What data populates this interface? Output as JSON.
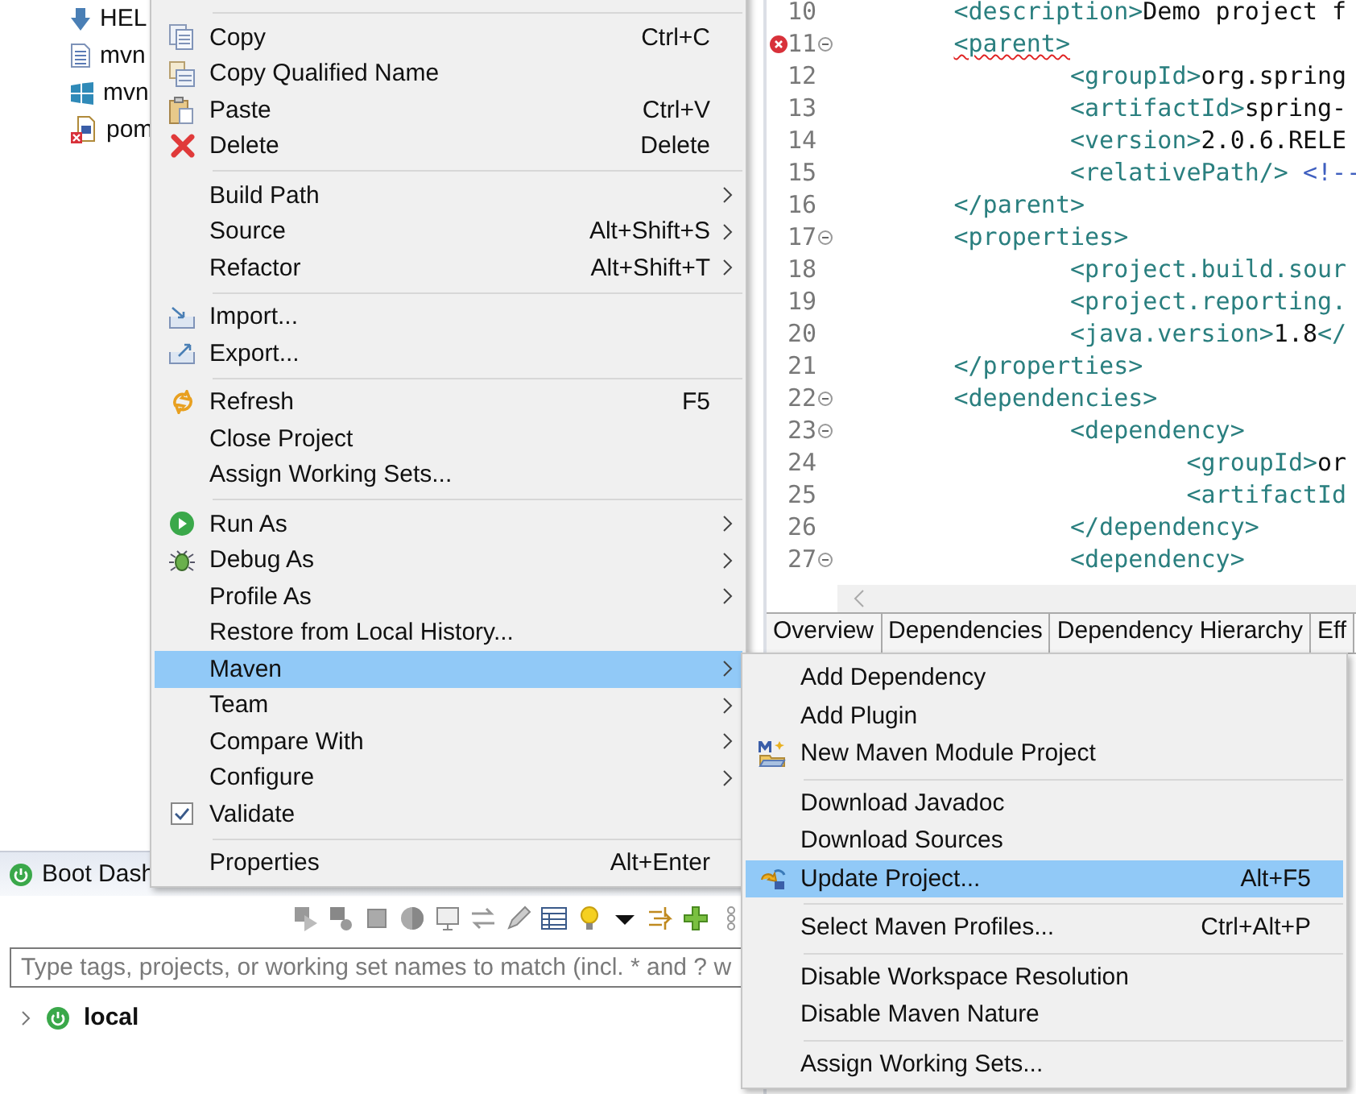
{
  "explorer": {
    "items": [
      {
        "label": "HEL"
      },
      {
        "label": "mvn"
      },
      {
        "label": "mvn"
      },
      {
        "label": "pom"
      }
    ]
  },
  "boot_dashboard": {
    "tab": {
      "label": "Boot Dash"
    },
    "search": {
      "placeholder": "Type tags, projects, or working set names to match (incl. * and ? w"
    },
    "tree": [
      {
        "label": "local",
        "expanded": false
      }
    ]
  },
  "editor": {
    "lines": [
      {
        "number": "10",
        "parts": [
          {
            "kind": "tag",
            "text": "<description>"
          },
          {
            "kind": "text",
            "text": "Demo project f"
          }
        ]
      },
      {
        "number": "11",
        "error": true,
        "fold": true,
        "parts": [
          {
            "kind": "tag",
            "text": "<parent>"
          }
        ],
        "children": [
          {
            "number": "12",
            "parts": [
              {
                "kind": "tag",
                "text": "<groupId>"
              },
              {
                "kind": "text",
                "text": "org.spring"
              }
            ]
          },
          {
            "number": "13",
            "parts": [
              {
                "kind": "tag",
                "text": "<artifactId>"
              },
              {
                "kind": "text",
                "text": "spring-"
              }
            ]
          },
          {
            "number": "14",
            "parts": [
              {
                "kind": "tag",
                "text": "<version>"
              },
              {
                "kind": "text",
                "text": "2.0.6.RELE"
              }
            ]
          },
          {
            "number": "15",
            "parts": [
              {
                "kind": "tag",
                "text": "<relativePath/>"
              },
              {
                "kind": "comment",
                "text": "<!--"
              }
            ]
          }
        ]
      },
      {
        "number": "16",
        "parts": [
          {
            "kind": "tag",
            "text": "</parent>"
          }
        ]
      },
      {
        "number": "17",
        "fold": true,
        "parts": [
          {
            "kind": "tag",
            "text": "<properties>"
          }
        ],
        "children": [
          {
            "number": "18",
            "parts": [
              {
                "kind": "tag",
                "text": "<project.build.sour"
              }
            ]
          },
          {
            "number": "19",
            "parts": [
              {
                "kind": "tag",
                "text": "<project.reporting."
              }
            ]
          },
          {
            "number": "20",
            "parts": [
              {
                "kind": "tag",
                "text": "<java.version>"
              },
              {
                "kind": "text",
                "text": "1.8"
              },
              {
                "kind": "tag",
                "text": "</"
              }
            ]
          }
        ]
      },
      {
        "number": "21",
        "parts": [
          {
            "kind": "tag",
            "text": "</properties>"
          }
        ]
      },
      {
        "number": "22",
        "fold": true,
        "parts": [
          {
            "kind": "tag",
            "text": "<dependencies>"
          }
        ],
        "children": [
          {
            "number": "23",
            "fold": true,
            "parts": [
              {
                "kind": "tag",
                "text": "<dependency>"
              }
            ],
            "children": [
              {
                "number": "24",
                "parts": [
                  {
                    "kind": "tag",
                    "text": "<groupId>"
                  },
                  {
                    "kind": "text",
                    "text": "or"
                  }
                ]
              },
              {
                "number": "25",
                "parts": [
                  {
                    "kind": "tag",
                    "text": "<artifactId"
                  }
                ]
              }
            ]
          },
          {
            "number": "26",
            "parts": [
              {
                "kind": "tag",
                "text": "</dependency>"
              }
            ]
          },
          {
            "number": "27",
            "fold": true,
            "parts": [
              {
                "kind": "tag",
                "text": "<dependency>"
              }
            ]
          }
        ]
      }
    ],
    "tabs": [
      {
        "label": "Overview"
      },
      {
        "label": "Dependencies"
      },
      {
        "label": "Dependency Hierarchy"
      },
      {
        "label": "Eff"
      }
    ]
  },
  "context_menu": {
    "items": [
      {
        "kind": "separator"
      },
      {
        "kind": "item",
        "label": "Copy",
        "shortcut": "Ctrl+C",
        "submenu": false,
        "selected": false,
        "checked": false
      },
      {
        "kind": "item",
        "label": "Copy Qualified Name",
        "submenu": false,
        "selected": false,
        "checked": false
      },
      {
        "kind": "item",
        "label": "Paste",
        "shortcut": "Ctrl+V",
        "submenu": false,
        "selected": false,
        "checked": false
      },
      {
        "kind": "item",
        "label": "Delete",
        "shortcut": "Delete",
        "submenu": false,
        "selected": false,
        "checked": false
      },
      {
        "kind": "separator"
      },
      {
        "kind": "item",
        "label": "Build Path",
        "submenu": true,
        "selected": false,
        "checked": false
      },
      {
        "kind": "item",
        "label": "Source",
        "shortcut": "Alt+Shift+S",
        "submenu": true,
        "selected": false,
        "checked": false
      },
      {
        "kind": "item",
        "label": "Refactor",
        "shortcut": "Alt+Shift+T",
        "submenu": true,
        "selected": false,
        "checked": false
      },
      {
        "kind": "separator"
      },
      {
        "kind": "item",
        "label": "Import...",
        "submenu": false,
        "selected": false,
        "checked": false
      },
      {
        "kind": "item",
        "label": "Export...",
        "submenu": false,
        "selected": false,
        "checked": false
      },
      {
        "kind": "separator"
      },
      {
        "kind": "item",
        "label": "Refresh",
        "shortcut": "F5",
        "submenu": false,
        "selected": false,
        "checked": false
      },
      {
        "kind": "item",
        "label": "Close Project",
        "submenu": false,
        "selected": false,
        "checked": false
      },
      {
        "kind": "item",
        "label": "Assign Working Sets...",
        "submenu": false,
        "selected": false,
        "checked": false
      },
      {
        "kind": "separator"
      },
      {
        "kind": "item",
        "label": "Run As",
        "submenu": true,
        "selected": false,
        "checked": false
      },
      {
        "kind": "item",
        "label": "Debug As",
        "submenu": true,
        "selected": false,
        "checked": false
      },
      {
        "kind": "item",
        "label": "Profile As",
        "submenu": true,
        "selected": false,
        "checked": false
      },
      {
        "kind": "item",
        "label": "Restore from Local History...",
        "submenu": false,
        "selected": false,
        "checked": false
      },
      {
        "kind": "item",
        "label": "Maven",
        "submenu": true,
        "selected": true,
        "checked": false
      },
      {
        "kind": "item",
        "label": "Team",
        "submenu": true,
        "selected": false,
        "checked": false
      },
      {
        "kind": "item",
        "label": "Compare With",
        "submenu": true,
        "selected": false,
        "checked": false
      },
      {
        "kind": "item",
        "label": "Configure",
        "submenu": true,
        "selected": false,
        "checked": false
      },
      {
        "kind": "item",
        "label": "Validate",
        "submenu": false,
        "selected": false,
        "checked": true
      },
      {
        "kind": "separator"
      },
      {
        "kind": "item",
        "label": "Properties",
        "shortcut": "Alt+Enter",
        "submenu": false,
        "selected": false,
        "checked": false
      }
    ]
  },
  "maven_submenu": {
    "items": [
      {
        "kind": "item",
        "label": "Add Dependency",
        "selected": false
      },
      {
        "kind": "item",
        "label": "Add Plugin",
        "selected": false
      },
      {
        "kind": "item",
        "label": "New Maven Module Project",
        "selected": false
      },
      {
        "kind": "separator"
      },
      {
        "kind": "item",
        "label": "Download Javadoc",
        "selected": false
      },
      {
        "kind": "item",
        "label": "Download Sources",
        "selected": false
      },
      {
        "kind": "item",
        "label": "Update Project...",
        "shortcut": "Alt+F5",
        "selected": true
      },
      {
        "kind": "separator"
      },
      {
        "kind": "item",
        "label": "Select Maven Profiles...",
        "shortcut": "Ctrl+Alt+P",
        "selected": false
      },
      {
        "kind": "separator"
      },
      {
        "kind": "item",
        "label": "Disable Workspace Resolution",
        "selected": false
      },
      {
        "kind": "item",
        "label": "Disable Maven Nature",
        "selected": false
      },
      {
        "kind": "separator"
      },
      {
        "kind": "item",
        "label": "Assign Working Sets...",
        "selected": false
      }
    ]
  }
}
